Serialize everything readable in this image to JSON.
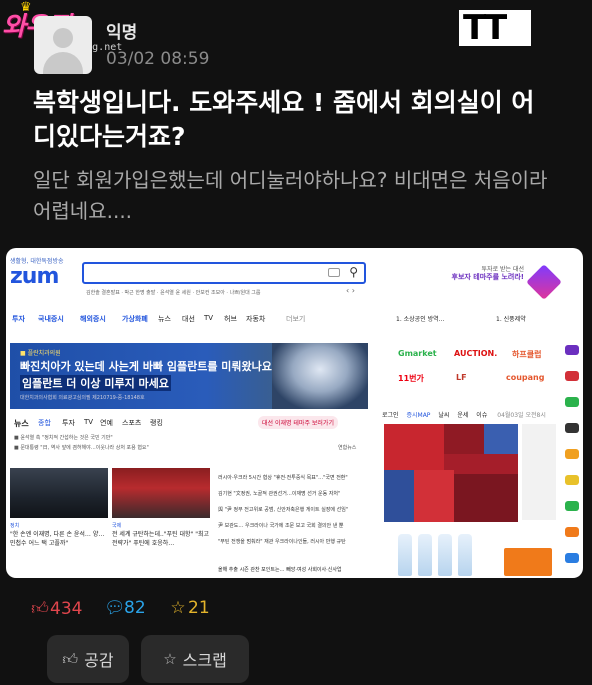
{
  "watermark": {
    "logo": "와우짱",
    "url": "foto-wang.net"
  },
  "post": {
    "author": "익명",
    "date": "03/02 08:59",
    "brand": "TT",
    "title": "복학생입니다. 도와주세요 ! 줌에서 회의실이 어디있다는거죠?",
    "body": "일단 회원가입은했는데 어디눌러야하나요? 비대면은 처음이라 어렵네요...."
  },
  "screenshot": {
    "tagline": "생활형, 대한독점방송",
    "logo": "zum",
    "search_tags": "김한솔 결혼발표 · 박근 한명 출발 · 윤석열 윤 세원 · 안보컨 조모아 · 나쁘/원대 그룹",
    "promo_line1": "투자로 받는 대선",
    "promo_line2": "후보자 테마주를 노려라!",
    "nav": [
      "투자",
      "국내증시",
      "해외증시",
      "가상화폐",
      "뉴스",
      "대선",
      "TV",
      "허브",
      "자동차",
      "더보기"
    ],
    "rank1": "1. 소상공인 방역...",
    "rank2": "1. 신풍제약",
    "banner_sub": "■ 플란치과의원",
    "banner_line1": "빠진치아가 있는데 사는게 바빠 임플란트를 미뤄왔나요?",
    "banner_line2": "임플란트 더 이상 미루지 마세요",
    "banner_note": "대한치과의사협회 의료광고심의필 제210719-중-18148호",
    "news_tabs": [
      "뉴스",
      "종합",
      "투자",
      "TV",
      "연예",
      "스포츠",
      "랭킹"
    ],
    "news_pill": "대선 이재명 테마주 보러가기",
    "headline1": "■ 윤석열 측 \"정치적 간섭하는 것은 국민 기만\"",
    "headline2": "■ 문대통령 \"日, 역사 앞에 겸허해야…이웃나라 상처 포용 협요\"",
    "source1": "연합뉴스",
    "cat1": "정치",
    "cap1": "\"한 손엔 이재명, 다른 손 윤석… 양… 민첩수 어느 택 고플까\"",
    "cat2": "국제",
    "cap2": "전 세계 규탄하는데..\"푸틴 대항\" \"최고 전략가\" 푸틴에 호응하…",
    "list": [
      "러시아·우크라 5시간 협상 \"휴전·전투중식 목표\"…\"국면 전환\"",
      "김기현 \"文정권, 노골적 관권선거…이재명 선거 운동 자처\"",
      "與 \"尹 정부 전고위로 공범, 신안저축은행 게이트 실장에 선임\"",
      "尹 보관도… 우크라이나 국가에 조문 보고 국회 결의안 낸 뿐",
      "\"푸틴 전쟁을 멈춰라\" 재관 우크라이나인들, 러시아 만행 규탄"
    ],
    "bottom_line": "올해 추출 시즌 관찬 포인트는… 빼앙·여성 사회이사·신사업",
    "markets": [
      "Gmarket",
      "AUCTION.",
      "하프클럽",
      "11번가",
      "LF",
      "coupang"
    ],
    "stock_tabs": [
      "로그인",
      "증시MAP",
      "날씨",
      "운세",
      "이슈"
    ],
    "stock_note": "04월03일 오전8시"
  },
  "stats": {
    "likes": "434",
    "comments": "82",
    "scraps": "21"
  },
  "actions": {
    "like_label": "공감",
    "scrap_label": "스크랩"
  },
  "colors": {
    "background": "#111111",
    "like": "#e0464d",
    "comment": "#2aa3e8",
    "scrap": "#e4b42b"
  },
  "icons": [
    "thumbs-up-icon",
    "comment-icon",
    "star-icon"
  ]
}
